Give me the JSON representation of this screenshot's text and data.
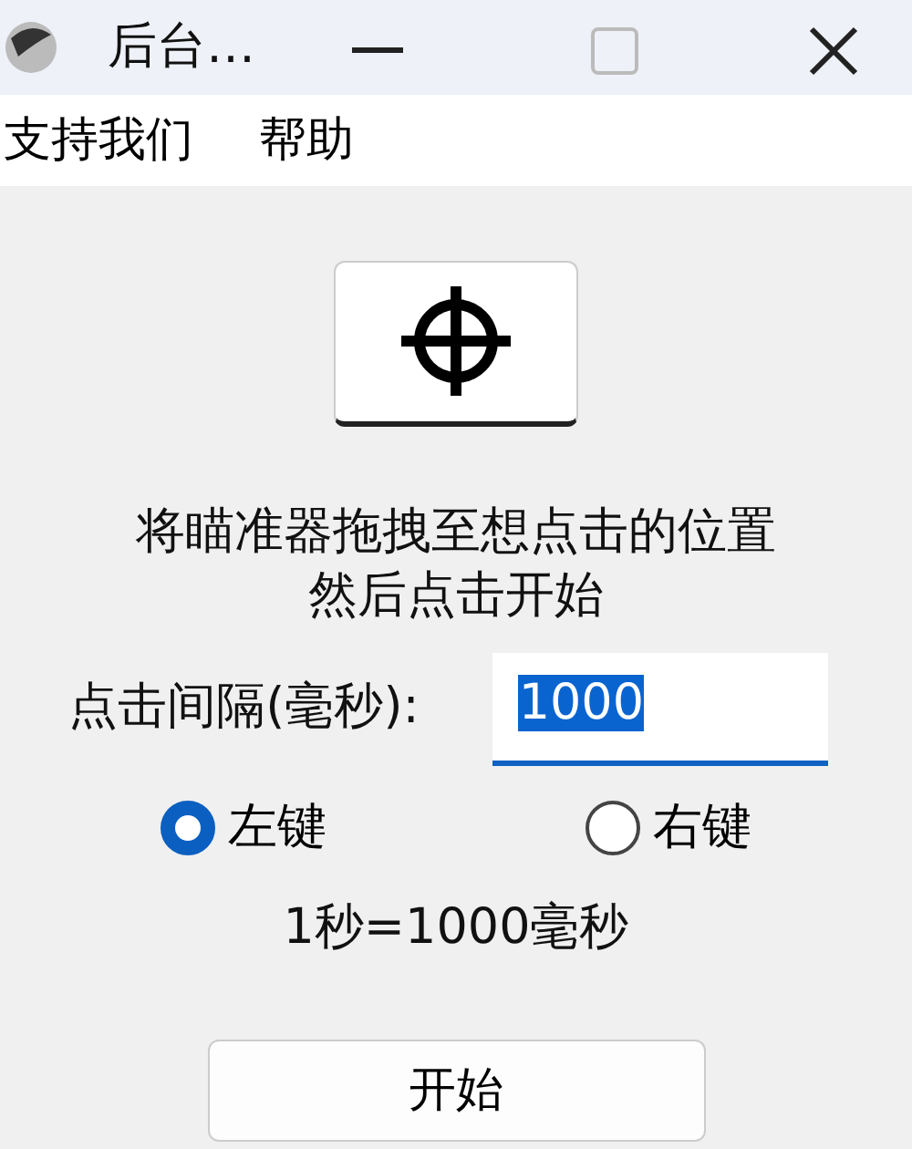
{
  "window": {
    "title": "后台…"
  },
  "menu": [
    {
      "label": "支持我们"
    },
    {
      "label": "帮助"
    }
  ],
  "instructions": [
    "将瞄准器拖拽至想点击的位置",
    "然后点击开始"
  ],
  "interval": {
    "label": "点击间隔(毫秒):",
    "value": "1000"
  },
  "mouse_buttons": [
    {
      "label": "左键",
      "selected": true
    },
    {
      "label": "右键",
      "selected": false
    }
  ],
  "note": "1秒=1000毫秒",
  "start_button": "开始"
}
